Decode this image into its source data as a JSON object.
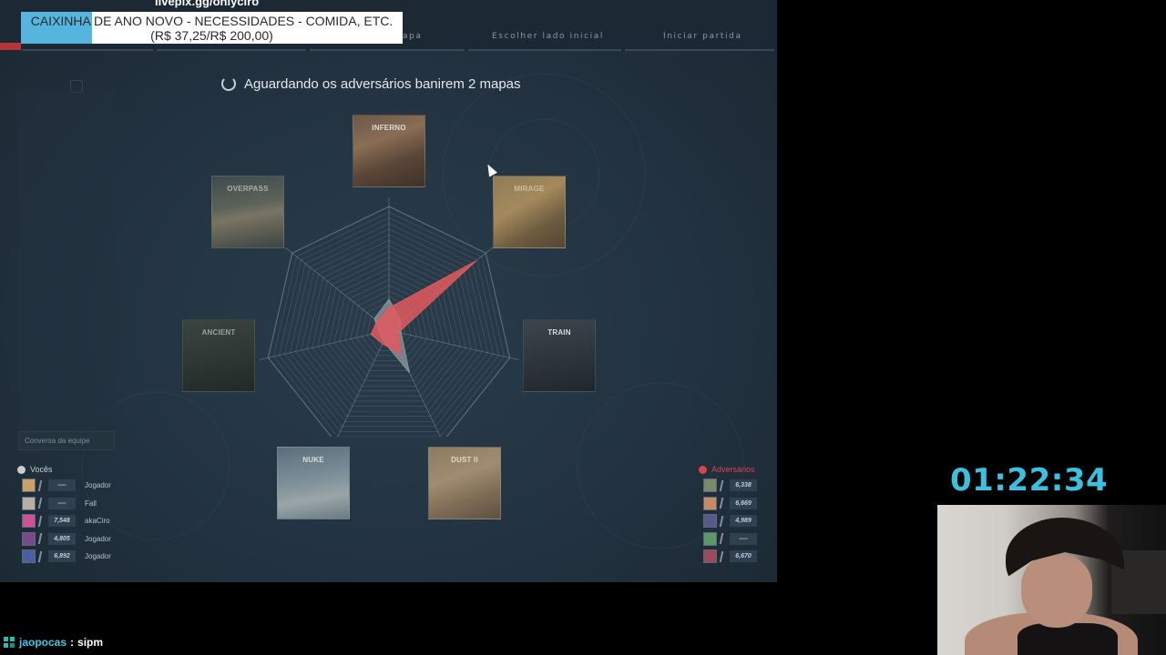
{
  "overlay": {
    "livepix_url": "livepix.gg/onlyciro",
    "goal_title": "CAIXINHA DE ANO NOVO - NECESSIDADES - COMIDA, ETC.",
    "goal_amount": "(R$ 37,25/R$ 200,00)",
    "goal_progress": 0.186,
    "goal_color": "#56b5de",
    "stream_timer": "01:22:34",
    "chat_user": "jaopocas",
    "chat_sep": ":",
    "chat_message": "sipm"
  },
  "game": {
    "steps": [
      "apa",
      "Escolher lado inicial",
      "Iniciar partida"
    ],
    "status_text": "Aguardando os adversários banirem 2 mapas",
    "chat_placeholder": "Conversa da equipe",
    "maps": [
      {
        "name": "INFERNO"
      },
      {
        "name": "MIRAGE"
      },
      {
        "name": "TRAIN"
      },
      {
        "name": "DUST II"
      },
      {
        "name": "NUKE"
      },
      {
        "name": "ANCIENT"
      },
      {
        "name": "OVERPASS"
      }
    ],
    "radar_values": {
      "team": [
        0.18,
        0.9,
        0.08,
        0.22,
        0.12,
        0.15,
        0.12
      ],
      "enemy": [
        0.25,
        0.12,
        0.1,
        0.38,
        0.1,
        0.08,
        0.15
      ]
    },
    "colors": {
      "team": "#e05a5e",
      "enemy": "#8c98a0",
      "team_accent": "#c7ced3",
      "enemy_accent": "#d9454b"
    },
    "team": {
      "label": "Vocês",
      "players": [
        {
          "rating": "----",
          "name": "Jogador",
          "avatar_color": "#c9a06a"
        },
        {
          "rating": "----",
          "name": "Fall",
          "avatar_color": "#b8b0a8"
        },
        {
          "rating": "7,548",
          "name": "akaCiro",
          "avatar_color": "#d0509a"
        },
        {
          "rating": "4,805",
          "name": "Jogador",
          "avatar_color": "#7a4a8a"
        },
        {
          "rating": "6,892",
          "name": "Jogador",
          "avatar_color": "#4a5fa0"
        }
      ]
    },
    "enemy": {
      "label": "Adversários",
      "players": [
        {
          "rating": "6,338",
          "avatar_color": "#7a8a6a"
        },
        {
          "rating": "6,669",
          "avatar_color": "#c78c62"
        },
        {
          "rating": "4,989",
          "avatar_color": "#5a5a8a"
        },
        {
          "rating": "----",
          "avatar_color": "#5a9a6a"
        },
        {
          "rating": "6,670",
          "avatar_color": "#9a4a5a"
        }
      ]
    }
  }
}
